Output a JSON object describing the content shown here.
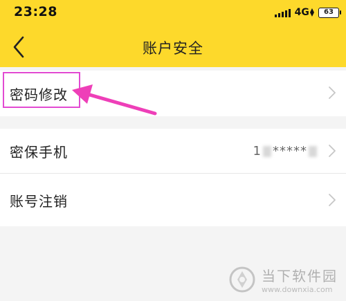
{
  "status_bar": {
    "time": "23:28",
    "network": "4G",
    "battery": "63"
  },
  "header": {
    "title": "账户安全",
    "back_icon": "chevron-left-icon",
    "background": "#fdd92b"
  },
  "menu": {
    "items": [
      {
        "label": "密码修改",
        "value": ""
      },
      {
        "label": "密保手机",
        "value_prefix": "1",
        "value_masked": "*****"
      },
      {
        "label": "账号注销",
        "value": ""
      }
    ]
  },
  "annotation": {
    "color": "#e24ad2"
  },
  "watermark": {
    "title": "当下软件园",
    "url": "www.downxia.com"
  }
}
